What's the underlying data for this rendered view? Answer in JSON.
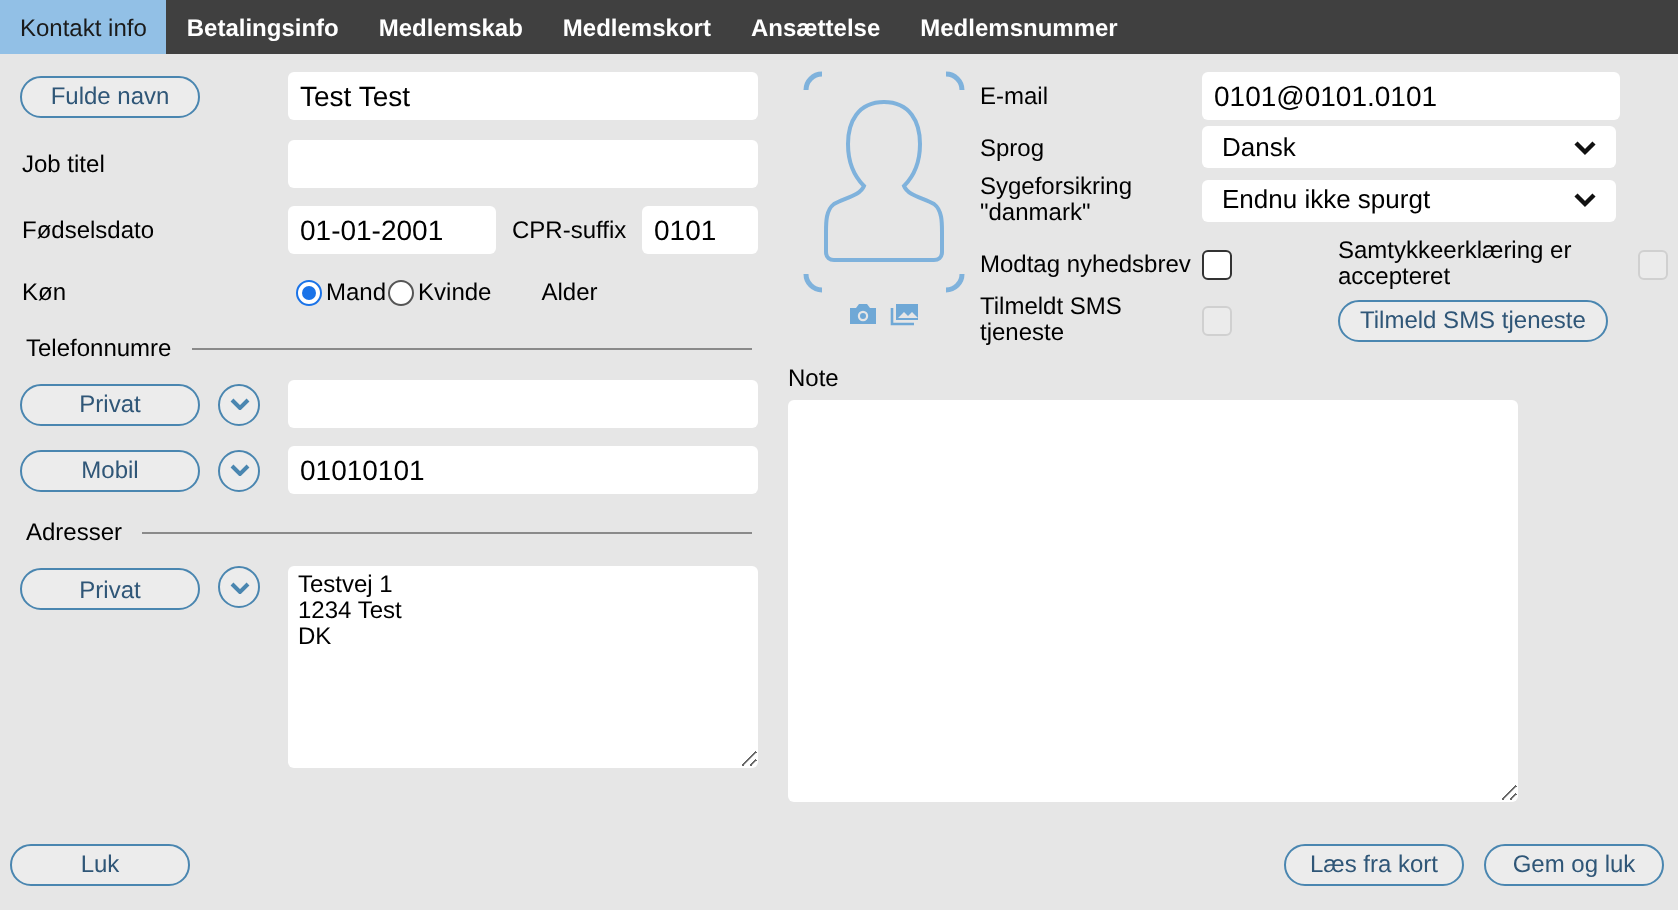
{
  "tabs": [
    {
      "label": "Kontakt info",
      "selected": true
    },
    {
      "label": "Betalingsinfo",
      "selected": false
    },
    {
      "label": "Medlemskab",
      "selected": false
    },
    {
      "label": "Medlemskort",
      "selected": false
    },
    {
      "label": "Ansættelse",
      "selected": false
    },
    {
      "label": "Medlemsnummer",
      "selected": false
    }
  ],
  "person": {
    "full_name_button": "Fulde navn",
    "full_name": "Test Test",
    "job_title_label": "Job titel",
    "birth_date_label": "Fødselsdato",
    "birth_date": "01-01-2001",
    "cpr_label": "CPR-suffix",
    "cpr": "0101",
    "gender_label": "Køn",
    "gender_options": [
      {
        "label": "Mand",
        "selected": true
      },
      {
        "label": "Kvinde",
        "selected": false
      }
    ],
    "age_label": "Alder"
  },
  "phones": {
    "title": "Telefonnumre",
    "items": [
      {
        "type": "Privat"
      },
      {
        "type": "Mobil",
        "value": "01010101"
      }
    ]
  },
  "addresses": {
    "title": "Adresser",
    "items": [
      {
        "type": "Privat",
        "value": "Testvej 1\n1234 Test\nDK"
      }
    ]
  },
  "contact": {
    "email_label": "E-mail",
    "email": "0101@0101.0101",
    "language_label": "Sprog",
    "language": "Dansk",
    "insurance_label": "Sygeforsikring \"danmark\"",
    "insurance": "Endnu ikke spurgt",
    "newsletter": {
      "label": "Modtag nyhedsbrev",
      "checked": false,
      "disabled": false
    },
    "consent": {
      "label": "Samtykkeerklæring er accepteret",
      "checked": false,
      "disabled": true
    },
    "sms": {
      "label": "Tilmeldt SMS tjeneste",
      "checked": false,
      "disabled": true
    },
    "sms_button": "Tilmeld SMS tjeneste"
  },
  "note_label": "Note",
  "close_button": "Luk",
  "actions": [
    "Læs fra kort",
    "Gem og luk"
  ]
}
